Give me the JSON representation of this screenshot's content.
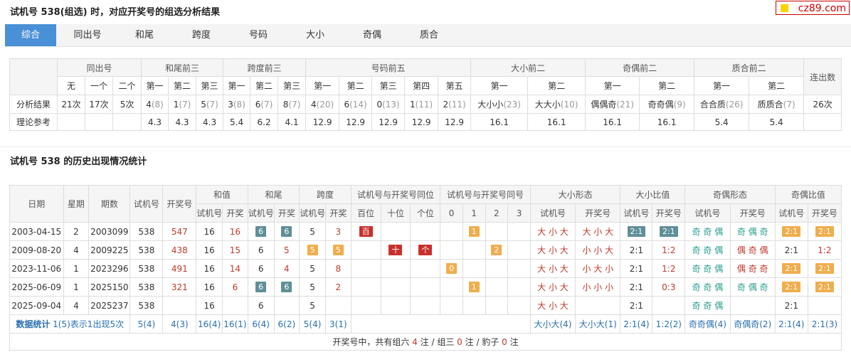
{
  "page": {
    "title": "试机号 538(组选) 时，对应开奖号的组选分析结果",
    "section2_title": "试机号 538 的历史出现情况统计",
    "logo": "cz89.com"
  },
  "tabs": [
    "综合",
    "同出号",
    "和尾",
    "跨度",
    "号码",
    "大小",
    "奇偶",
    "质合"
  ],
  "analysis": {
    "groups": [
      "同出号",
      "和尾前三",
      "跨度前三",
      "号码前五",
      "大小前二",
      "奇偶前二",
      "质合前二",
      "连出数"
    ],
    "sub": {
      "tongchu": [
        "无",
        "一个",
        "二个"
      ],
      "hewei": [
        "第一",
        "第二",
        "第三"
      ],
      "kuadu": [
        "第一",
        "第二",
        "第三"
      ],
      "haoma": [
        "第一",
        "第二",
        "第三",
        "第四",
        "第五"
      ],
      "daxiao": [
        "第一",
        "第二"
      ],
      "jiou": [
        "第一",
        "第二"
      ],
      "zhihe": [
        "第一",
        "第二"
      ]
    },
    "row_labels": [
      "分析结果",
      "理论参考"
    ],
    "result": [
      {
        "v": "21次",
        "n": ""
      },
      {
        "v": "17次",
        "n": ""
      },
      {
        "v": "5次",
        "n": ""
      },
      {
        "v": "4",
        "n": "(8)"
      },
      {
        "v": "1",
        "n": "(7)"
      },
      {
        "v": "5",
        "n": "(7)"
      },
      {
        "v": "3",
        "n": "(8)"
      },
      {
        "v": "6",
        "n": "(7)"
      },
      {
        "v": "8",
        "n": "(7)"
      },
      {
        "v": "4",
        "n": "(20)"
      },
      {
        "v": "6",
        "n": "(14)"
      },
      {
        "v": "0",
        "n": "(13)"
      },
      {
        "v": "1",
        "n": "(11)"
      },
      {
        "v": "2",
        "n": "(11)"
      },
      {
        "v": "大小小",
        "n": "(23)"
      },
      {
        "v": "大大小",
        "n": "(10)"
      },
      {
        "v": "偶偶奇",
        "n": "(21)"
      },
      {
        "v": "奇奇偶",
        "n": "(9)"
      },
      {
        "v": "合合质",
        "n": "(26)"
      },
      {
        "v": "质质合",
        "n": "(7)"
      },
      {
        "v": "26次",
        "n": ""
      }
    ],
    "reference": [
      "",
      "",
      "",
      "4.3",
      "4.3",
      "4.3",
      "5.4",
      "6.2",
      "4.1",
      "12.9",
      "12.9",
      "12.9",
      "12.9",
      "12.9",
      "16.1",
      "16.1",
      "16.1",
      "16.1",
      "5.4",
      "5.4",
      ""
    ]
  },
  "history": {
    "headers": {
      "date": "日期",
      "week": "星期",
      "issue": "期数",
      "test": "试机号",
      "draw": "开奖号",
      "sum": "和值",
      "tail": "和尾",
      "span": "跨度",
      "samepos": "试机号与开奖号同位",
      "same": "试机号与开奖号同号",
      "bigsmall": "大小形态",
      "bsratio": "大小比值",
      "oddeven": "奇偶形态",
      "oeratio": "奇偶比值"
    },
    "sub": {
      "test": "试机号",
      "draw": "开奖",
      "pos": [
        "百位",
        "十位",
        "个位"
      ],
      "same": [
        "0",
        "1",
        "2",
        "3"
      ],
      "test2": "试机号",
      "draw2": "开奖号"
    },
    "rows": [
      {
        "date": "2003-04-15",
        "week": "2",
        "issue": "2003099",
        "test": "538",
        "draw": "547",
        "sum_t": "16",
        "sum_d": "16",
        "tail_t": "6",
        "tail_d": "6",
        "span_t": "5",
        "span_d": "3",
        "pos": [
          "百",
          "",
          ""
        ],
        "same": [
          "",
          "1",
          "",
          ""
        ],
        "bs_t": "大 小 大",
        "bs_d": "大 小 大",
        "bsr_t": "2:1",
        "bsr_d": "2:1",
        "oe_t": "奇 奇 偶",
        "oe_d": "奇 偶 奇",
        "oer_t": "2:1",
        "oer_d": "2:1"
      },
      {
        "date": "2009-08-20",
        "week": "4",
        "issue": "2009225",
        "test": "538",
        "draw": "438",
        "sum_t": "16",
        "sum_d": "15",
        "tail_t": "6",
        "tail_d": "5",
        "span_t": "5",
        "span_d": "5",
        "pos": [
          "",
          "十",
          "个"
        ],
        "same": [
          "",
          "",
          "2",
          ""
        ],
        "bs_t": "大 小 大",
        "bs_d": "小 小 大",
        "bsr_t": "2:1",
        "bsr_d": "1:2",
        "oe_t": "奇 奇 偶",
        "oe_d": "偶 奇 偶",
        "oer_t": "2:1",
        "oer_d": "1:2"
      },
      {
        "date": "2023-11-06",
        "week": "1",
        "issue": "2023296",
        "test": "538",
        "draw": "491",
        "sum_t": "16",
        "sum_d": "14",
        "tail_t": "6",
        "tail_d": "4",
        "span_t": "5",
        "span_d": "8",
        "pos": [
          "",
          "",
          ""
        ],
        "same": [
          "0",
          "",
          "",
          ""
        ],
        "bs_t": "大 小 大",
        "bs_d": "小 大 小",
        "bsr_t": "2:1",
        "bsr_d": "1:2",
        "oe_t": "奇 奇 偶",
        "oe_d": "偶 奇 奇",
        "oer_t": "2:1",
        "oer_d": "2:1"
      },
      {
        "date": "2025-06-09",
        "week": "1",
        "issue": "2025150",
        "test": "538",
        "draw": "321",
        "sum_t": "16",
        "sum_d": "6",
        "tail_t": "6",
        "tail_d": "6",
        "span_t": "5",
        "span_d": "2",
        "pos": [
          "",
          "",
          ""
        ],
        "same": [
          "",
          "1",
          "",
          ""
        ],
        "bs_t": "大 小 大",
        "bs_d": "小 小 小",
        "bsr_t": "2:1",
        "bsr_d": "0:3",
        "oe_t": "奇 奇 偶",
        "oe_d": "奇 偶 奇",
        "oer_t": "2:1",
        "oer_d": "2:1"
      },
      {
        "date": "2025-09-04",
        "week": "4",
        "issue": "2025237",
        "test": "538",
        "draw": "",
        "sum_t": "16",
        "sum_d": "",
        "tail_t": "6",
        "tail_d": "",
        "span_t": "5",
        "span_d": "",
        "pos": [
          "",
          "",
          ""
        ],
        "same": [
          "",
          "",
          "",
          ""
        ],
        "bs_t": "大 小 大",
        "bs_d": "",
        "bsr_t": "2:1",
        "bsr_d": "",
        "oe_t": "奇 奇 偶",
        "oe_d": "",
        "oer_t": "2:1",
        "oer_d": ""
      }
    ],
    "stats": {
      "label": "数据统计",
      "note": "1(5)表示1出现5次",
      "test": "5(4)",
      "draw": "4(3)",
      "sum_t": "16(4)",
      "sum_d": "16(1)",
      "tail_t": "6(4)",
      "tail_d": "6(2)",
      "span_t": "5(4)",
      "span_d": "3(1)",
      "bs_t": "大小大(4)",
      "bs_d": "大小大(1)",
      "bsr_t": "2:1(4)",
      "bsr_d": "1:2(2)",
      "oe_t": "奇奇偶(4)",
      "oe_d": "奇偶奇(2)",
      "oer_t": "2:1(4)",
      "oer_d": "2:1(3)"
    },
    "footer": {
      "pre": "开奖号中，共有组六 ",
      "n6": "4",
      "mid1": " 注 / 组三 ",
      "n3": "0",
      "mid2": " 注 / 豹子 ",
      "nb": "0",
      "post": " 注"
    }
  },
  "colors": {
    "accent": "#4a90d6",
    "red": "#c0392b",
    "orange": "#f0ad4e",
    "slate": "#5f8f98",
    "teal": "#2a9d8f"
  }
}
